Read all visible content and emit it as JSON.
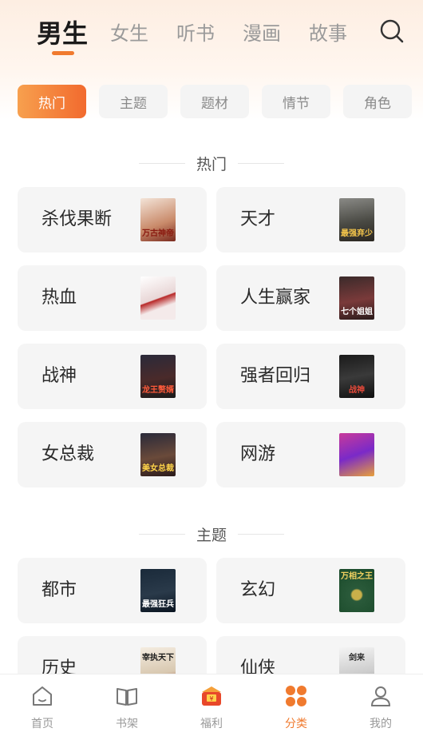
{
  "tabs": [
    {
      "label": "男生",
      "active": true
    },
    {
      "label": "女生",
      "active": false
    },
    {
      "label": "听书",
      "active": false
    },
    {
      "label": "漫画",
      "active": false
    },
    {
      "label": "故事",
      "active": false
    }
  ],
  "search_icon": "search-icon",
  "chips": [
    {
      "label": "热门",
      "active": true
    },
    {
      "label": "主题",
      "active": false
    },
    {
      "label": "题材",
      "active": false
    },
    {
      "label": "情节",
      "active": false
    },
    {
      "label": "角色",
      "active": false
    }
  ],
  "sections": [
    {
      "title": "热门",
      "items": [
        {
          "label": "杀伐果断",
          "cover_text": "万古神帝"
        },
        {
          "label": "天才",
          "cover_text": "最强弃少"
        },
        {
          "label": "热血",
          "cover_text": ""
        },
        {
          "label": "人生赢家",
          "cover_text": "七个姐姐"
        },
        {
          "label": "战神",
          "cover_text": "龙王赘婿"
        },
        {
          "label": "强者回归",
          "cover_text": "战神"
        },
        {
          "label": "女总裁",
          "cover_text": "美女总裁"
        },
        {
          "label": "网游",
          "cover_text": ""
        }
      ]
    },
    {
      "title": "主题",
      "items": [
        {
          "label": "都市",
          "cover_text": "最强狂兵"
        },
        {
          "label": "玄幻",
          "cover_text": "万相之王"
        },
        {
          "label": "历史",
          "cover_text": "宰执天下"
        },
        {
          "label": "仙侠",
          "cover_text": "剑来"
        }
      ]
    }
  ],
  "nav": [
    {
      "label": "首页",
      "icon": "home-icon",
      "active": false
    },
    {
      "label": "书架",
      "icon": "bookshelf-icon",
      "active": false
    },
    {
      "label": "福利",
      "icon": "welfare-gift-icon",
      "active": false
    },
    {
      "label": "分类",
      "icon": "category-icon",
      "active": true
    },
    {
      "label": "我的",
      "icon": "profile-icon",
      "active": false
    }
  ],
  "colors": {
    "accent": "#f07a2e",
    "card_bg": "#f5f5f5",
    "chip_bg": "#f4f4f4"
  }
}
